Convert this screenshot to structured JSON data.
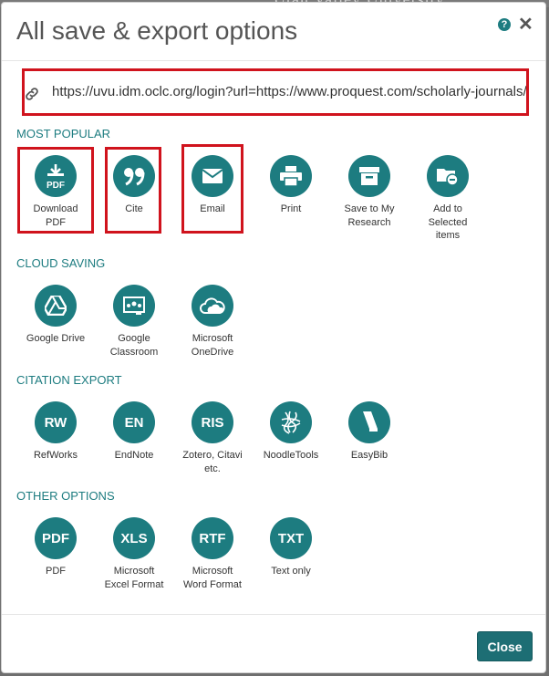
{
  "background": {
    "text": "Utah Valley University"
  },
  "dialog": {
    "title": "All save & export options",
    "help": "?",
    "close_x": "✕",
    "url": "https://uvu.idm.oclc.org/login?url=https://www.proquest.com/scholarly-journals/e",
    "close_button": "Close"
  },
  "sections": {
    "most_popular": {
      "title": "MOST POPULAR",
      "items": [
        {
          "label": "Download\nPDF",
          "icon": "download-pdf-icon",
          "glyph": "PDF"
        },
        {
          "label": "Cite",
          "icon": "quote-icon"
        },
        {
          "label": "Email",
          "icon": "envelope-icon"
        },
        {
          "label": "Print",
          "icon": "printer-icon"
        },
        {
          "label": "Save to My\nResearch",
          "icon": "archive-box-icon"
        },
        {
          "label": "Add to\nSelected\nitems",
          "icon": "folder-add-icon"
        }
      ]
    },
    "cloud_saving": {
      "title": "CLOUD SAVING",
      "items": [
        {
          "label": "Google Drive",
          "icon": "google-drive-icon"
        },
        {
          "label": "Google\nClassroom",
          "icon": "google-classroom-icon"
        },
        {
          "label": "Microsoft\nOneDrive",
          "icon": "onedrive-cloud-icon"
        }
      ]
    },
    "citation_export": {
      "title": "CITATION EXPORT",
      "items": [
        {
          "label": "RefWorks",
          "glyph": "RW"
        },
        {
          "label": "EndNote",
          "glyph": "EN"
        },
        {
          "label": "Zotero, Citavi\netc.",
          "glyph": "RIS"
        },
        {
          "label": "NoodleTools",
          "icon": "noodletools-icon"
        },
        {
          "label": "EasyBib",
          "icon": "easybib-icon"
        }
      ]
    },
    "other_options": {
      "title": "OTHER OPTIONS",
      "items": [
        {
          "label": "PDF",
          "glyph": "PDF"
        },
        {
          "label": "Microsoft\nExcel Format",
          "glyph": "XLS"
        },
        {
          "label": "Microsoft\nWord Format",
          "glyph": "RTF"
        },
        {
          "label": "Text only",
          "glyph": "TXT"
        }
      ]
    }
  },
  "colors": {
    "accent": "#1d7c80",
    "highlight": "#d0131d",
    "close_button": "#1d6e74"
  }
}
